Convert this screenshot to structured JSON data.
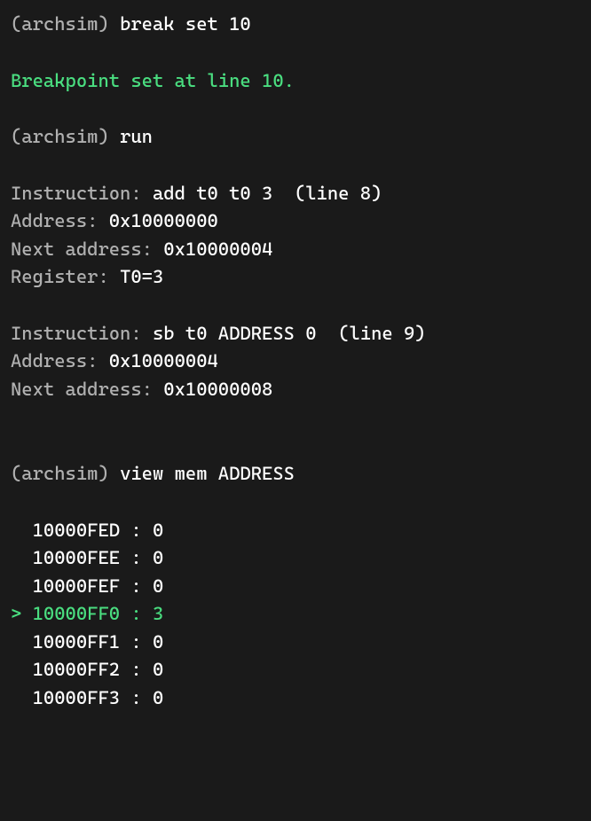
{
  "prompt": "(archsim)",
  "commands": {
    "break": "break set 10",
    "run": "run",
    "view": "view mem ADDRESS"
  },
  "breakpoint_msg": "Breakpoint set at line 10.",
  "instr1": {
    "label": "Instruction:",
    "text": "add t0 t0 3  (line 8)",
    "addr_label": "Address:",
    "addr": "0x10000000",
    "next_label": "Next address:",
    "next": "0x10000004",
    "reg_label": "Register:",
    "reg": "T0=3"
  },
  "instr2": {
    "label": "Instruction:",
    "text": "sb t0 ADDRESS 0  (line 9)",
    "addr_label": "Address:",
    "addr": "0x10000004",
    "next_label": "Next address:",
    "next": "0x10000008"
  },
  "memory": {
    "rows": [
      {
        "marker": "  ",
        "addr": "10000FED",
        "sep": " : ",
        "val": "0"
      },
      {
        "marker": "  ",
        "addr": "10000FEE",
        "sep": " : ",
        "val": "0"
      },
      {
        "marker": "  ",
        "addr": "10000FEF",
        "sep": " : ",
        "val": "0"
      },
      {
        "marker": "> ",
        "addr": "10000FF0",
        "sep": " : ",
        "val": "3"
      },
      {
        "marker": "  ",
        "addr": "10000FF1",
        "sep": " : ",
        "val": "0"
      },
      {
        "marker": "  ",
        "addr": "10000FF2",
        "sep": " : ",
        "val": "0"
      },
      {
        "marker": "  ",
        "addr": "10000FF3",
        "sep": " : ",
        "val": "0"
      }
    ],
    "highlight_index": 3
  }
}
